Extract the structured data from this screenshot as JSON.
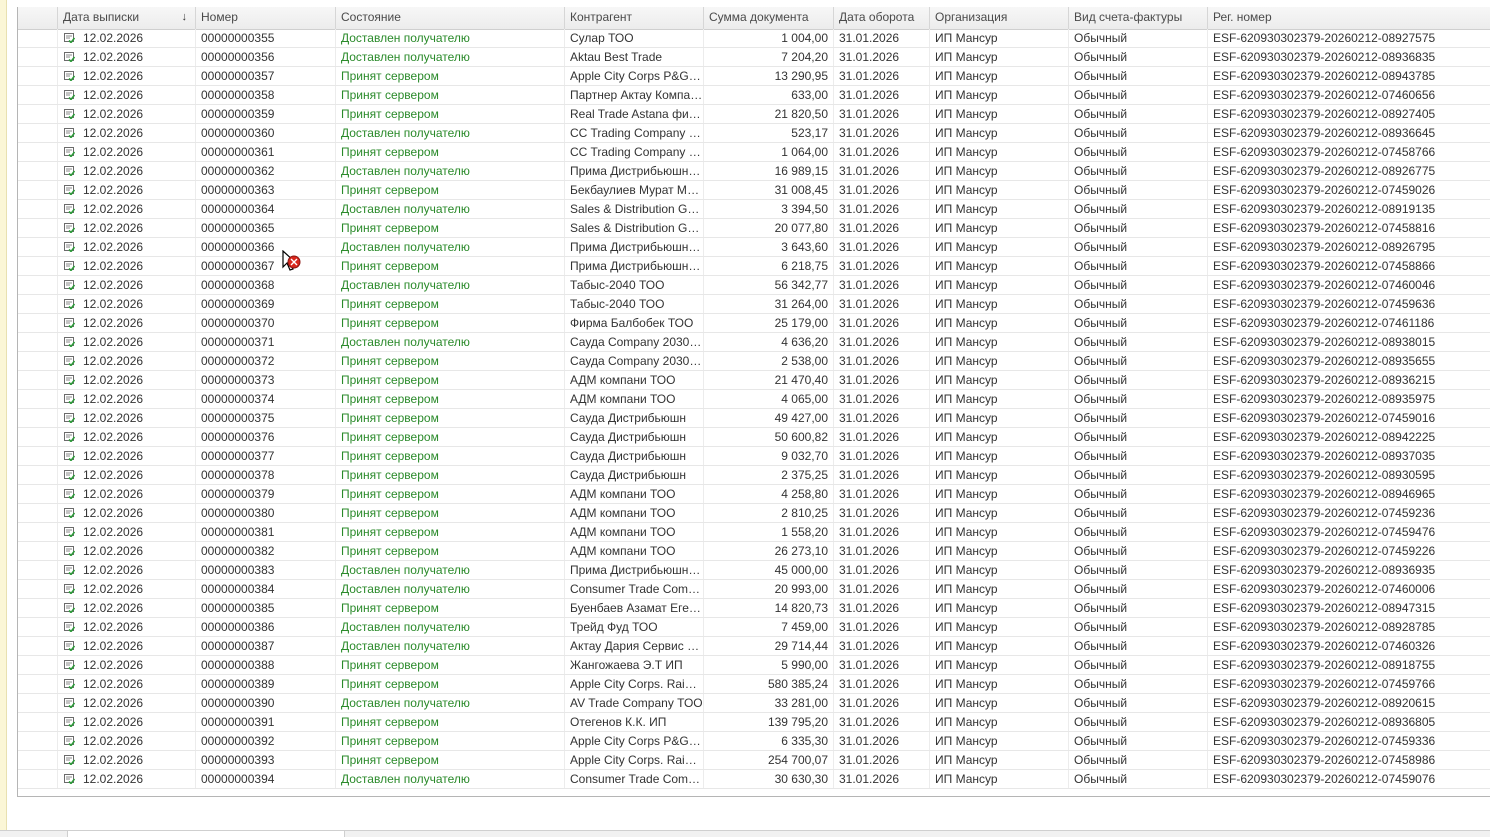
{
  "columns": {
    "date": "Дата выписки",
    "number": "Номер",
    "state": "Состояние",
    "counterparty": "Контрагент",
    "amount": "Сумма документа",
    "turnover_date": "Дата оборота",
    "organization": "Организация",
    "invoice_kind": "Вид счета-фактуры",
    "reg_number": "Рег. номер",
    "sort_indicator": "↓"
  },
  "colors": {
    "state_text": "#2a8a2a",
    "header_bg": "#ececec",
    "icon_green": "#2e9a3a"
  },
  "row_icon": "document-check-icon",
  "rows": [
    {
      "date": "12.02.2026",
      "number": "00000000355",
      "state": "Доставлен получателю",
      "counterparty": "Сулар ТОО",
      "amount": "1 004,00",
      "turnover": "31.01.2026",
      "org": "ИП Мансур",
      "kind": "Обычный",
      "reg": "ESF-620930302379-20260212-08927575"
    },
    {
      "date": "12.02.2026",
      "number": "00000000356",
      "state": "Доставлен получателю",
      "counterparty": "Aktau Best Trade",
      "amount": "7 204,20",
      "turnover": "31.01.2026",
      "org": "ИП Мансур",
      "kind": "Обычный",
      "reg": "ESF-620930302379-20260212-08936835"
    },
    {
      "date": "12.02.2026",
      "number": "00000000357",
      "state": "Принят сервером",
      "counterparty": "Apple City Corps P&G ТОО",
      "amount": "13 290,95",
      "turnover": "31.01.2026",
      "org": "ИП Мансур",
      "kind": "Обычный",
      "reg": "ESF-620930302379-20260212-08943785"
    },
    {
      "date": "12.02.2026",
      "number": "00000000358",
      "state": "Принят сервером",
      "counterparty": "Партнер Актау Компани...",
      "amount": "633,00",
      "turnover": "31.01.2026",
      "org": "ИП Мансур",
      "kind": "Обычный",
      "reg": "ESF-620930302379-20260212-07460656"
    },
    {
      "date": "12.02.2026",
      "number": "00000000359",
      "state": "Принят сервером",
      "counterparty": "Real Trade Astana филиа...",
      "amount": "21 820,50",
      "turnover": "31.01.2026",
      "org": "ИП Мансур",
      "kind": "Обычный",
      "reg": "ESF-620930302379-20260212-08927405"
    },
    {
      "date": "12.02.2026",
      "number": "00000000360",
      "state": "Доставлен получателю",
      "counterparty": "CC Trading Company ТОО",
      "amount": "523,17",
      "turnover": "31.01.2026",
      "org": "ИП Мансур",
      "kind": "Обычный",
      "reg": "ESF-620930302379-20260212-08936645"
    },
    {
      "date": "12.02.2026",
      "number": "00000000361",
      "state": "Принят сервером",
      "counterparty": "CC Trading Company ТОО",
      "amount": "1 064,00",
      "turnover": "31.01.2026",
      "org": "ИП Мансур",
      "kind": "Обычный",
      "reg": "ESF-620930302379-20260212-07458766"
    },
    {
      "date": "12.02.2026",
      "number": "00000000362",
      "state": "Доставлен получателю",
      "counterparty": "Прима Дистрибьюшн Т...",
      "amount": "16 989,15",
      "turnover": "31.01.2026",
      "org": "ИП Мансур",
      "kind": "Обычный",
      "reg": "ESF-620930302379-20260212-08926775"
    },
    {
      "date": "12.02.2026",
      "number": "00000000363",
      "state": "Принят сервером",
      "counterparty": "Бекбаулиев Мурат Мадр...",
      "amount": "31 008,45",
      "turnover": "31.01.2026",
      "org": "ИП Мансур",
      "kind": "Обычный",
      "reg": "ESF-620930302379-20260212-07459026"
    },
    {
      "date": "12.02.2026",
      "number": "00000000364",
      "state": "Доставлен получателю",
      "counterparty": "Sales & Distribution Group...",
      "amount": "3 394,50",
      "turnover": "31.01.2026",
      "org": "ИП Мансур",
      "kind": "Обычный",
      "reg": "ESF-620930302379-20260212-08919135"
    },
    {
      "date": "12.02.2026",
      "number": "00000000365",
      "state": "Принят сервером",
      "counterparty": "Sales & Distribution Group...",
      "amount": "20 077,80",
      "turnover": "31.01.2026",
      "org": "ИП Мансур",
      "kind": "Обычный",
      "reg": "ESF-620930302379-20260212-07458816"
    },
    {
      "date": "12.02.2026",
      "number": "00000000366",
      "state": "Доставлен получателю",
      "counterparty": "Прима Дистрибьюшн Т...",
      "amount": "3 643,60",
      "turnover": "31.01.2026",
      "org": "ИП Мансур",
      "kind": "Обычный",
      "reg": "ESF-620930302379-20260212-08926795"
    },
    {
      "date": "12.02.2026",
      "number": "00000000367",
      "state": "Принят сервером",
      "counterparty": "Прима Дистрибьюшн Т...",
      "amount": "6 218,75",
      "turnover": "31.01.2026",
      "org": "ИП Мансур",
      "kind": "Обычный",
      "reg": "ESF-620930302379-20260212-07458866"
    },
    {
      "date": "12.02.2026",
      "number": "00000000368",
      "state": "Доставлен получателю",
      "counterparty": "Табыс-2040 ТОО",
      "amount": "56 342,77",
      "turnover": "31.01.2026",
      "org": "ИП Мансур",
      "kind": "Обычный",
      "reg": "ESF-620930302379-20260212-07460046"
    },
    {
      "date": "12.02.2026",
      "number": "00000000369",
      "state": "Принят сервером",
      "counterparty": "Табыс-2040 ТОО",
      "amount": "31 264,00",
      "turnover": "31.01.2026",
      "org": "ИП Мансур",
      "kind": "Обычный",
      "reg": "ESF-620930302379-20260212-07459636"
    },
    {
      "date": "12.02.2026",
      "number": "00000000370",
      "state": "Принят сервером",
      "counterparty": "Фирма Балбобек ТОО",
      "amount": "25 179,00",
      "turnover": "31.01.2026",
      "org": "ИП Мансур",
      "kind": "Обычный",
      "reg": "ESF-620930302379-20260212-07461186"
    },
    {
      "date": "12.02.2026",
      "number": "00000000371",
      "state": "Доставлен получателю",
      "counterparty": "Сауда Company 2030 ТОО",
      "amount": "4 636,20",
      "turnover": "31.01.2026",
      "org": "ИП Мансур",
      "kind": "Обычный",
      "reg": "ESF-620930302379-20260212-08938015"
    },
    {
      "date": "12.02.2026",
      "number": "00000000372",
      "state": "Принят сервером",
      "counterparty": "Сауда Company 2030 ТОО",
      "amount": "2 538,00",
      "turnover": "31.01.2026",
      "org": "ИП Мансур",
      "kind": "Обычный",
      "reg": "ESF-620930302379-20260212-08935655"
    },
    {
      "date": "12.02.2026",
      "number": "00000000373",
      "state": "Принят сервером",
      "counterparty": "АДМ компани ТОО",
      "amount": "21 470,40",
      "turnover": "31.01.2026",
      "org": "ИП Мансур",
      "kind": "Обычный",
      "reg": "ESF-620930302379-20260212-08936215"
    },
    {
      "date": "12.02.2026",
      "number": "00000000374",
      "state": "Принят сервером",
      "counterparty": "АДМ компани ТОО",
      "amount": "4 065,00",
      "turnover": "31.01.2026",
      "org": "ИП Мансур",
      "kind": "Обычный",
      "reg": "ESF-620930302379-20260212-08935975"
    },
    {
      "date": "12.02.2026",
      "number": "00000000375",
      "state": "Принят сервером",
      "counterparty": "Сауда Дистрибьюшн",
      "amount": "49 427,00",
      "turnover": "31.01.2026",
      "org": "ИП Мансур",
      "kind": "Обычный",
      "reg": "ESF-620930302379-20260212-07459016"
    },
    {
      "date": "12.02.2026",
      "number": "00000000376",
      "state": "Принят сервером",
      "counterparty": "Сауда Дистрибьюшн",
      "amount": "50 600,82",
      "turnover": "31.01.2026",
      "org": "ИП Мансур",
      "kind": "Обычный",
      "reg": "ESF-620930302379-20260212-08942225"
    },
    {
      "date": "12.02.2026",
      "number": "00000000377",
      "state": "Принят сервером",
      "counterparty": "Сауда Дистрибьюшн",
      "amount": "9 032,70",
      "turnover": "31.01.2026",
      "org": "ИП Мансур",
      "kind": "Обычный",
      "reg": "ESF-620930302379-20260212-08937035"
    },
    {
      "date": "12.02.2026",
      "number": "00000000378",
      "state": "Принят сервером",
      "counterparty": "Сауда Дистрибьюшн",
      "amount": "2 375,25",
      "turnover": "31.01.2026",
      "org": "ИП Мансур",
      "kind": "Обычный",
      "reg": "ESF-620930302379-20260212-08930595"
    },
    {
      "date": "12.02.2026",
      "number": "00000000379",
      "state": "Принят сервером",
      "counterparty": "АДМ компани ТОО",
      "amount": "4 258,80",
      "turnover": "31.01.2026",
      "org": "ИП Мансур",
      "kind": "Обычный",
      "reg": "ESF-620930302379-20260212-08946965"
    },
    {
      "date": "12.02.2026",
      "number": "00000000380",
      "state": "Принят сервером",
      "counterparty": "АДМ компани ТОО",
      "amount": "2 810,25",
      "turnover": "31.01.2026",
      "org": "ИП Мансур",
      "kind": "Обычный",
      "reg": "ESF-620930302379-20260212-07459236"
    },
    {
      "date": "12.02.2026",
      "number": "00000000381",
      "state": "Принят сервером",
      "counterparty": "АДМ компани ТОО",
      "amount": "1 558,20",
      "turnover": "31.01.2026",
      "org": "ИП Мансур",
      "kind": "Обычный",
      "reg": "ESF-620930302379-20260212-07459476"
    },
    {
      "date": "12.02.2026",
      "number": "00000000382",
      "state": "Принят сервером",
      "counterparty": "АДМ компани ТОО",
      "amount": "26 273,10",
      "turnover": "31.01.2026",
      "org": "ИП Мансур",
      "kind": "Обычный",
      "reg": "ESF-620930302379-20260212-07459226"
    },
    {
      "date": "12.02.2026",
      "number": "00000000383",
      "state": "Доставлен получателю",
      "counterparty": "Прима Дистрибьюшн Т...",
      "amount": "45 000,00",
      "turnover": "31.01.2026",
      "org": "ИП Мансур",
      "kind": "Обычный",
      "reg": "ESF-620930302379-20260212-08936935"
    },
    {
      "date": "12.02.2026",
      "number": "00000000384",
      "state": "Доставлен получателю",
      "counterparty": "Consumer Trade Company",
      "amount": "20 993,00",
      "turnover": "31.01.2026",
      "org": "ИП Мансур",
      "kind": "Обычный",
      "reg": "ESF-620930302379-20260212-07460006"
    },
    {
      "date": "12.02.2026",
      "number": "00000000385",
      "state": "Принят сервером",
      "counterparty": "Буенбаев Азамат Егенб...",
      "amount": "14 820,73",
      "turnover": "31.01.2026",
      "org": "ИП Мансур",
      "kind": "Обычный",
      "reg": "ESF-620930302379-20260212-08947315"
    },
    {
      "date": "12.02.2026",
      "number": "00000000386",
      "state": "Доставлен получателю",
      "counterparty": "Трейд Фуд ТОО",
      "amount": "7 459,00",
      "turnover": "31.01.2026",
      "org": "ИП Мансур",
      "kind": "Обычный",
      "reg": "ESF-620930302379-20260212-08928785"
    },
    {
      "date": "12.02.2026",
      "number": "00000000387",
      "state": "Доставлен получателю",
      "counterparty": "Актау Дария Сервис ТО...",
      "amount": "29 714,44",
      "turnover": "31.01.2026",
      "org": "ИП Мансур",
      "kind": "Обычный",
      "reg": "ESF-620930302379-20260212-07460326"
    },
    {
      "date": "12.02.2026",
      "number": "00000000388",
      "state": "Принят сервером",
      "counterparty": "Жангожаева Э.Т ИП",
      "amount": "5 990,00",
      "turnover": "31.01.2026",
      "org": "ИП Мансур",
      "kind": "Обычный",
      "reg": "ESF-620930302379-20260212-08918755"
    },
    {
      "date": "12.02.2026",
      "number": "00000000389",
      "state": "Принят сервером",
      "counterparty": "Apple City Corps. Rainbo...",
      "amount": "580 385,24",
      "turnover": "31.01.2026",
      "org": "ИП Мансур",
      "kind": "Обычный",
      "reg": "ESF-620930302379-20260212-07459766"
    },
    {
      "date": "12.02.2026",
      "number": "00000000390",
      "state": "Доставлен получателю",
      "counterparty": "AV Trade Company ТОО",
      "amount": "33 281,00",
      "turnover": "31.01.2026",
      "org": "ИП Мансур",
      "kind": "Обычный",
      "reg": "ESF-620930302379-20260212-08920615"
    },
    {
      "date": "12.02.2026",
      "number": "00000000391",
      "state": "Принят сервером",
      "counterparty": "Отегенов К.К. ИП",
      "amount": "139 795,20",
      "turnover": "31.01.2026",
      "org": "ИП Мансур",
      "kind": "Обычный",
      "reg": "ESF-620930302379-20260212-08936805"
    },
    {
      "date": "12.02.2026",
      "number": "00000000392",
      "state": "Принят сервером",
      "counterparty": "Apple City Corps P&G ТОО",
      "amount": "6 335,30",
      "turnover": "31.01.2026",
      "org": "ИП Мансур",
      "kind": "Обычный",
      "reg": "ESF-620930302379-20260212-07459336"
    },
    {
      "date": "12.02.2026",
      "number": "00000000393",
      "state": "Принят сервером",
      "counterparty": "Apple City Corps. Rainbo...",
      "amount": "254 700,07",
      "turnover": "31.01.2026",
      "org": "ИП Мансур",
      "kind": "Обычный",
      "reg": "ESF-620930302379-20260212-07458986"
    },
    {
      "date": "12.02.2026",
      "number": "00000000394",
      "state": "Доставлен получателю",
      "counterparty": "Consumer Trade Company",
      "amount": "30 630,30",
      "turnover": "31.01.2026",
      "org": "ИП Мансур",
      "kind": "Обычный",
      "reg": "ESF-620930302379-20260212-07459076"
    }
  ]
}
